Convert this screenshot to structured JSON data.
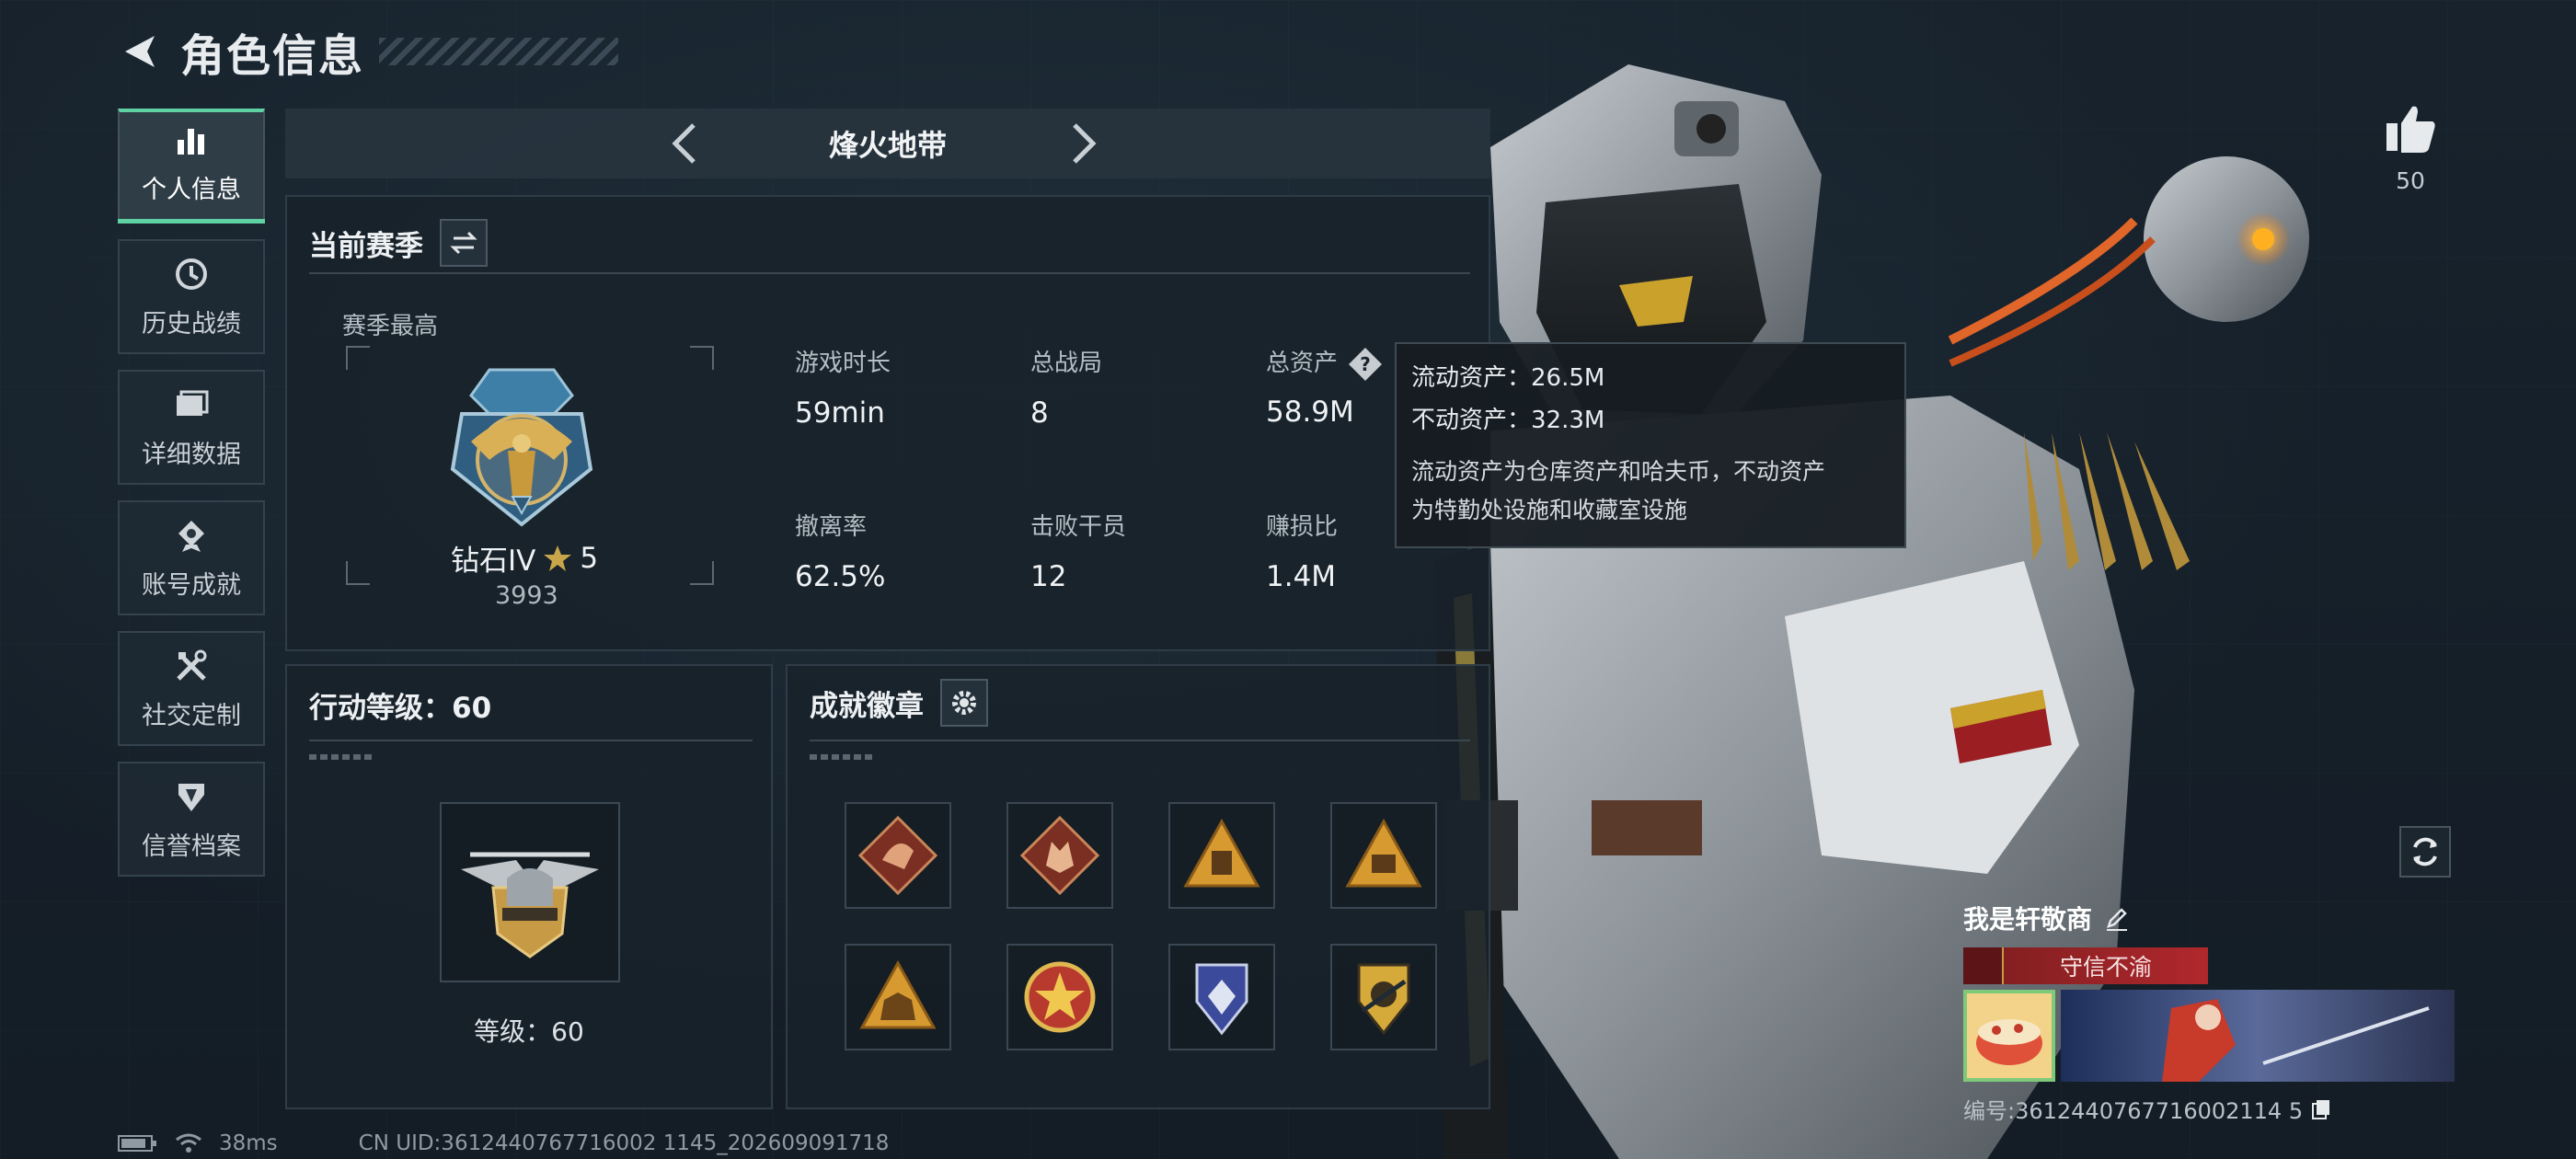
{
  "header": {
    "title": "角色信息"
  },
  "nav": [
    {
      "label": "个人信息",
      "icon": "bar-chart-icon",
      "active": true
    },
    {
      "label": "历史战绩",
      "icon": "clock-icon"
    },
    {
      "label": "详细数据",
      "icon": "folder-icon"
    },
    {
      "label": "账号成就",
      "icon": "achievement-icon"
    },
    {
      "label": "社交定制",
      "icon": "tools-icon"
    },
    {
      "label": "信誉档案",
      "icon": "shield-icon"
    }
  ],
  "mode": {
    "title": "烽火地带"
  },
  "season": {
    "title": "当前赛季",
    "best_label": "赛季最高",
    "rank_name": "钻石IV",
    "rank_stars": "5",
    "rank_score": "3993",
    "stats": [
      {
        "label": "游戏时长",
        "value": "59min"
      },
      {
        "label": "总战局",
        "value": "8"
      },
      {
        "label": "总资产",
        "value": "58.9M",
        "help": true
      },
      {
        "label": "撤离率",
        "value": "62.5%"
      },
      {
        "label": "击败干员",
        "value": "12"
      },
      {
        "label": "赚损比",
        "value": "1.4M"
      }
    ]
  },
  "tooltip": {
    "liquid": "流动资产：26.5M",
    "fixed": "不动资产：32.3M",
    "desc_1": "流动资产为仓库资产和哈夫币，不动资产",
    "desc_2": "为特勤处设施和收藏室设施"
  },
  "level": {
    "title": "行动等级：60",
    "label": "等级：60"
  },
  "achievements": {
    "title": "成就徽章",
    "badges": [
      "dragon-badge-icon",
      "wolf-badge-icon",
      "warning-box-badge-icon",
      "sb-badge-icon",
      "elephant-badge-icon",
      "star-medal-badge-icon",
      "crystal-shield-badge-icon",
      "crest-badge-icon"
    ]
  },
  "like": {
    "count": "50"
  },
  "player": {
    "name": "我是轩敬商",
    "title_badge": "守信不渝",
    "id": "编号:3612440767716002114 5"
  },
  "footer": {
    "ping": "38ms",
    "uid": "CN UID:3612440767716002 1145_202609091718"
  },
  "colors": {
    "accent": "#5fd1a3",
    "panel": "#18222a",
    "badge_red": "#b0282c",
    "gold": "#c59a45"
  }
}
